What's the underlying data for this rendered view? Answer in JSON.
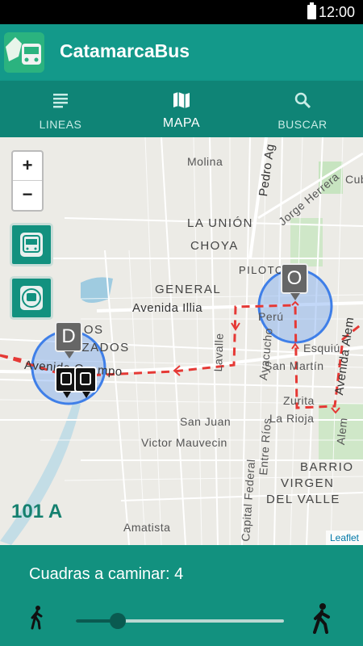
{
  "status_bar": {
    "time": "12:00"
  },
  "app": {
    "title": "CatamarcaBus"
  },
  "tabs": [
    {
      "label": "LINEAS",
      "icon": "list-icon"
    },
    {
      "label": "MAPA",
      "icon": "map-icon"
    },
    {
      "label": "BUSCAR",
      "icon": "search-icon"
    }
  ],
  "active_tab": "MAPA",
  "map": {
    "zoom_in": "+",
    "zoom_out": "−",
    "streets": {
      "molina": "Molina",
      "pedro": "Pedro Ag",
      "jorge": "Jorge Herrera",
      "cub": "Cub",
      "avenida_illia": "Avenida Illia",
      "lavalle": "Lavalle",
      "ayacucho": "Ayacucho",
      "peru": "Perú",
      "esquiu": "Esquiú",
      "san_martin": "San Martín",
      "zurita": "Zurita",
      "la_rioja": "La Rioja",
      "san_juan": "San Juan",
      "victor": "Victor Mauvecin",
      "entre_rios": "Entre Ríos",
      "capital": "Capital Federal",
      "amatista": "Amatista",
      "avenida_alem": "Avenida Alem",
      "alem": "Alem",
      "avenida_campo": "Avenida Ocampo"
    },
    "districts": {
      "la_union": "LA UNIÓN",
      "choya": "CHOYA",
      "piloto": "PILOTO",
      "general": "GENERAL",
      "ados": "ADOS",
      "azados": "AZADOS",
      "barrio": "BARRIO",
      "virgen": "VIRGEN",
      "del_valle": "DEL VALLE"
    },
    "marker_origin": "O",
    "marker_destination": "D",
    "route_name": "101 A",
    "attribution": "Leaflet"
  },
  "bottom": {
    "walk_label": "Cuadras a caminar: 4",
    "walk_value": 4,
    "walk_fraction": 0.2
  }
}
